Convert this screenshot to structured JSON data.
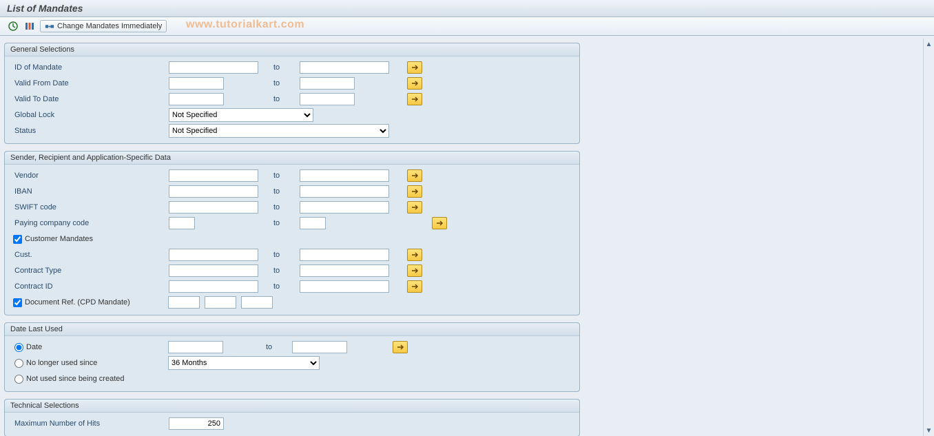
{
  "page": {
    "title": "List of Mandates"
  },
  "toolbar": {
    "change_label": "Change Mandates Immediately",
    "watermark": "www.tutorialkart.com"
  },
  "labels": {
    "to": "to"
  },
  "sections": {
    "general": {
      "title": "General Selections",
      "id_of_mandate": "ID of Mandate",
      "valid_from": "Valid From Date",
      "valid_to": "Valid To Date",
      "global_lock": "Global Lock",
      "status": "Status"
    },
    "sender": {
      "title": "Sender, Recipient and Application-Specific Data",
      "vendor": "Vendor",
      "iban": "IBAN",
      "swift": "SWIFT code",
      "paying_cc": "Paying company code",
      "customer_mandates": "Customer Mandates",
      "cust": "Cust.",
      "contract_type": "Contract Type",
      "contract_id": "Contract ID",
      "doc_ref": "Document Ref. (CPD Mandate)"
    },
    "date_last": {
      "title": "Date Last Used",
      "date": "Date",
      "no_longer": "No longer used since",
      "not_used": "Not used since being created"
    },
    "technical": {
      "title": "Technical Selections",
      "max_hits": "Maximum Number of Hits"
    }
  },
  "values": {
    "global_lock_selected": "Not Specified",
    "status_selected": "Not Specified",
    "customer_mandates_checked": true,
    "doc_ref_checked": true,
    "date_option": "date",
    "no_longer_selected": "36 Months",
    "max_hits": "250"
  }
}
